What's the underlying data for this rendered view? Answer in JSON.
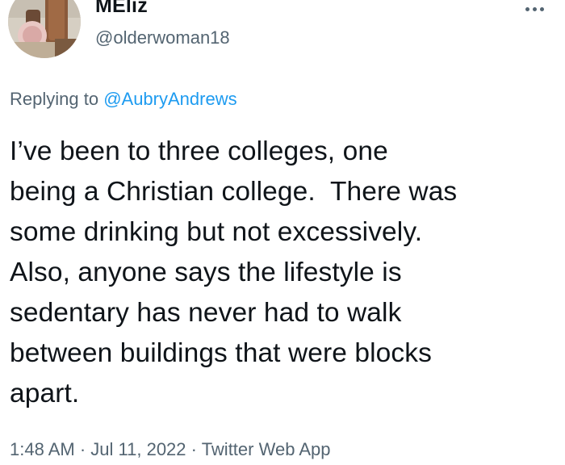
{
  "author": {
    "display_name": "MEliz",
    "handle": "@olderwoman18"
  },
  "menu": {
    "more_icon": "more-horizontal-icon"
  },
  "reply": {
    "prefix": "Replying to ",
    "mention": "@AubryAndrews"
  },
  "tweet": {
    "text": "I’ve been to three colleges, one\nbeing a Christian college.  There was\nsome drinking but not excessively.\nAlso, anyone says the lifestyle is\nsedentary has never had to walk\nbetween buildings that were blocks\napart."
  },
  "meta": {
    "time": "1:48 AM",
    "separator": " · ",
    "date": "Jul 11, 2022",
    "source": "Twitter Web App"
  },
  "colors": {
    "text": "#0f1419",
    "secondary": "#536471",
    "link": "#1d9bf0"
  }
}
